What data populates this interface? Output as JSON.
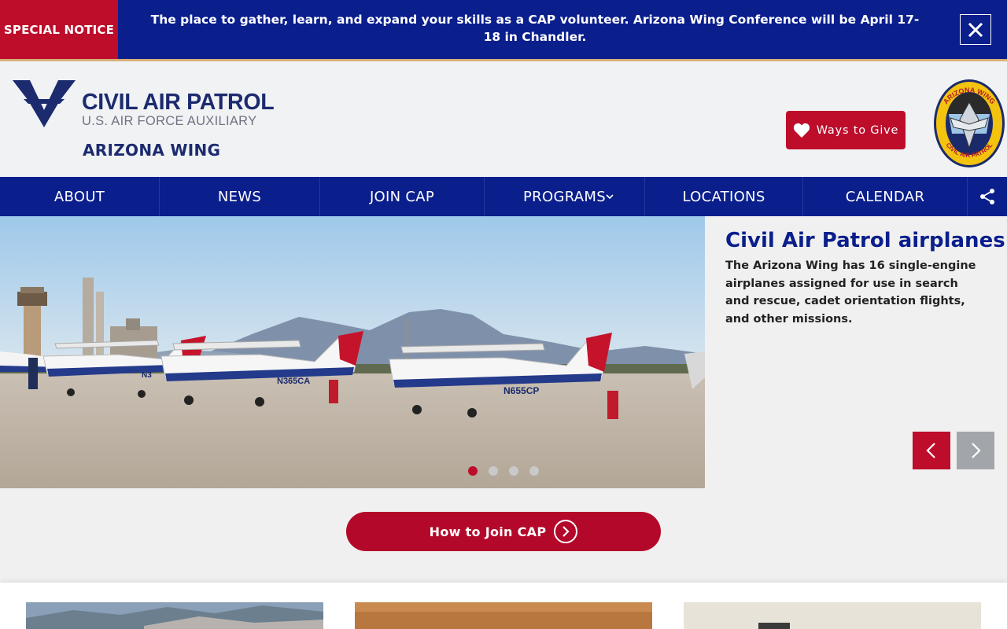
{
  "notice": {
    "tag": "SPECIAL NOTICE",
    "text": "The place to gather, learn, and expand your skills as a CAP volunteer. Arizona Wing Conference will be April 17-18 in Chandler.",
    "close_icon": "close-icon"
  },
  "header": {
    "logo_title": "CIVIL AIR PATROL",
    "logo_subtitle": "U.S. AIR FORCE AUXILIARY",
    "wing_name": "ARIZONA WING",
    "give_label": "Ways to Give",
    "give_icon": "heart-icon",
    "patch_top": "ARIZONA WING",
    "patch_bottom": "CIVIL AIR PATROL"
  },
  "nav": {
    "items": [
      {
        "label": "ABOUT"
      },
      {
        "label": "NEWS"
      },
      {
        "label": "JOIN CAP"
      },
      {
        "label": "PROGRAMS",
        "has_dropdown": true
      },
      {
        "label": "LOCATIONS"
      },
      {
        "label": "CALENDAR"
      }
    ],
    "share_icon": "share-icon"
  },
  "hero": {
    "title": "Civil Air Patrol airplanes",
    "description": "The Arizona Wing has 16 single-engine airplanes assigned for use in search and rescue, cadet orientation flights, and other missions.",
    "tail_numbers": [
      "N365CA",
      "N655CP",
      "N3"
    ],
    "slide_count": 4,
    "active_slide": 1
  },
  "join": {
    "label": "How to Join CAP",
    "icon": "chevron-circle-right-icon"
  },
  "colors": {
    "navy": "#0a1e8c",
    "red": "#bd0d2b",
    "brand_text": "#1c2b6e"
  }
}
